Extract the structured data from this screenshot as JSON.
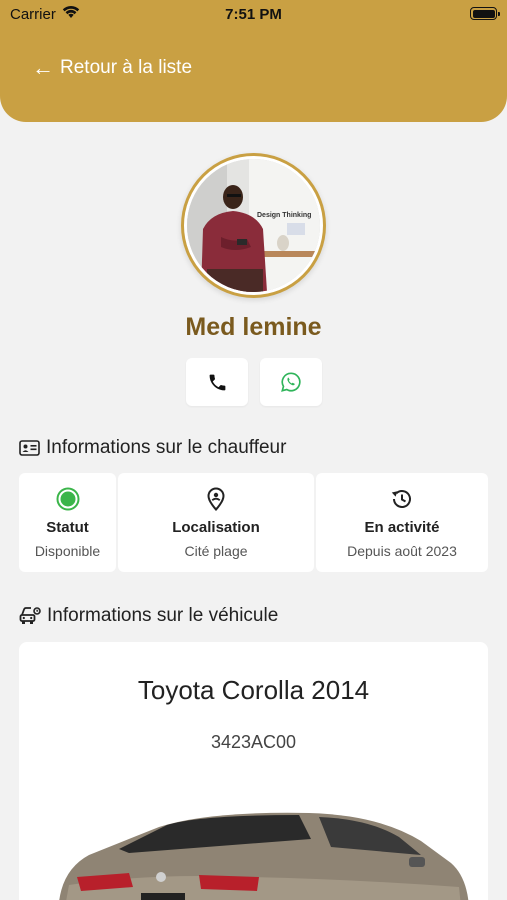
{
  "status_bar": {
    "carrier": "Carrier",
    "time": "7:51 PM"
  },
  "header": {
    "back_label": "Retour à la liste",
    "color": "#c9a043"
  },
  "driver": {
    "name": "Med lemine",
    "photo_text": "Design Thinking",
    "contact": {
      "call_icon": "phone-icon",
      "whatsapp_icon": "whatsapp-icon"
    }
  },
  "driver_section": {
    "title": "Informations sur le chauffeur",
    "cards": [
      {
        "label": "Statut",
        "value": "Disponible",
        "icon": "status-dot-icon",
        "color": "#3bb54a"
      },
      {
        "label": "Localisation",
        "value": "Cité plage",
        "icon": "location-pin-icon"
      },
      {
        "label": "En activité",
        "value": "Depuis août 2023",
        "icon": "history-icon"
      }
    ]
  },
  "vehicle_section": {
    "title": "Informations sur le véhicule",
    "model": "Toyota Corolla 2014",
    "plate": "3423AC00"
  }
}
